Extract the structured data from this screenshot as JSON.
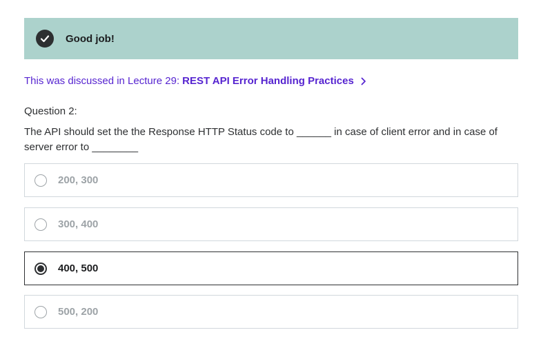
{
  "banner": {
    "icon": "check-circle-icon",
    "text": "Good job!"
  },
  "lecture_link": {
    "prefix": "This was discussed in Lecture 29:",
    "title": "REST API Error Handling Practices",
    "icon": "chevron-right-icon"
  },
  "question": {
    "label": "Question 2:",
    "text": "The API should set the the Response HTTP Status code to ______ in case of client error and in case of server error to ________"
  },
  "options": [
    {
      "label": "200, 300",
      "selected": false
    },
    {
      "label": "300, 400",
      "selected": false
    },
    {
      "label": "400, 500",
      "selected": true
    },
    {
      "label": "500, 200",
      "selected": false
    }
  ],
  "colors": {
    "banner_bg": "#acd2cc",
    "link": "#5624d0",
    "text": "#2d2f31"
  }
}
